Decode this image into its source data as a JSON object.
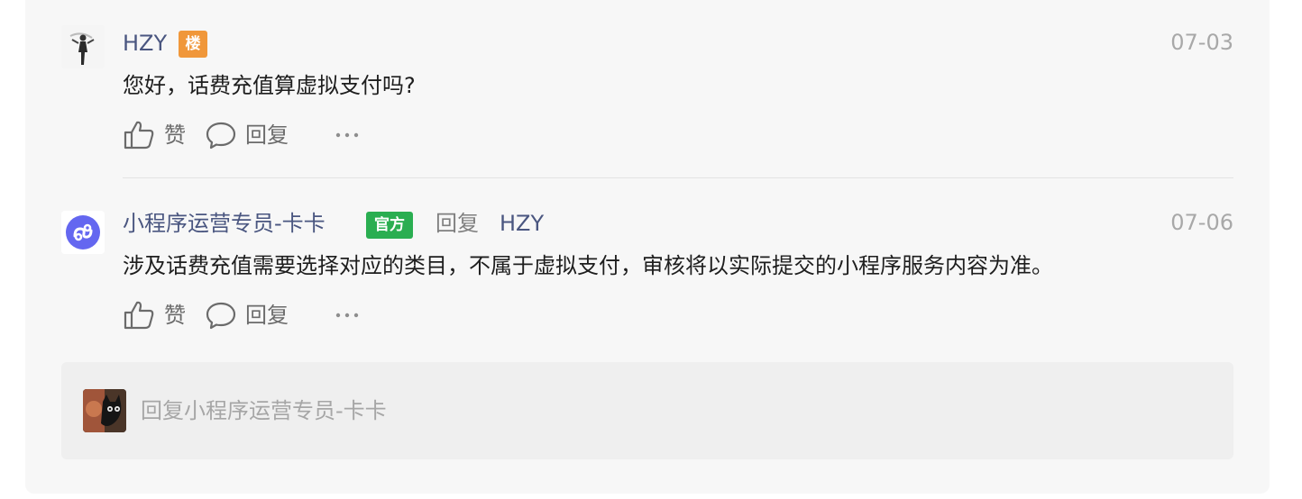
{
  "thread": {
    "post": {
      "author": "HZY",
      "author_badge": "楼",
      "date": "07-03",
      "content": "您好，话费充值算虚拟支付吗?",
      "actions": {
        "like_label": "赞",
        "reply_label": "回复",
        "more_label": "···"
      }
    },
    "reply": {
      "author": "小程序运营专员-卡卡",
      "author_badge": "官方",
      "reply_word": "回复",
      "reply_to": "HZY",
      "date": "07-06",
      "content": "涉及话费充值需要选择对应的类目，不属于虚拟支付，审核将以实际提交的小程序服务内容为准。",
      "actions": {
        "like_label": "赞",
        "reply_label": "回复",
        "more_label": "···"
      }
    },
    "reply_input": {
      "placeholder": "回复小程序运营专员-卡卡"
    }
  },
  "colors": {
    "author_name": "#4a5680",
    "floor_badge": "#f0973a",
    "official_badge": "#2aae51",
    "date": "#a8a8a8",
    "panel_bg": "#f7f7f7"
  },
  "icons": [
    "thumbs-up-icon",
    "comment-bubble-icon",
    "more-dots-icon",
    "mini-program-logo-icon"
  ]
}
